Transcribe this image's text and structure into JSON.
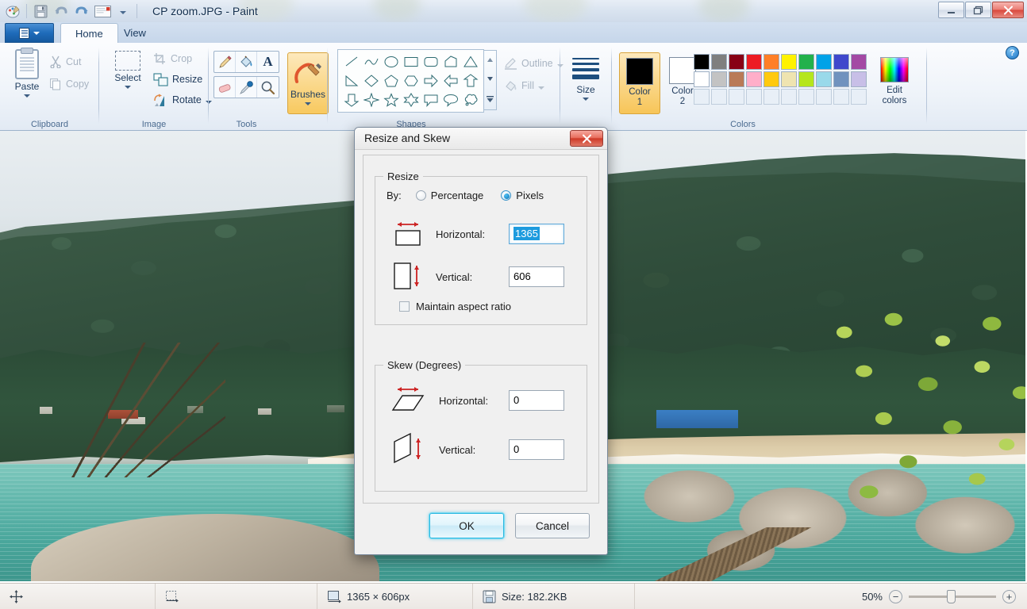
{
  "window": {
    "title": "CP zoom.JPG - Paint",
    "minimize_label": "—",
    "restore_label": "❐",
    "close_label": "✕",
    "help_label": "?"
  },
  "quick_access": {
    "items": [
      {
        "name": "paint-logo-icon",
        "label": ""
      },
      {
        "name": "save-icon",
        "label": ""
      },
      {
        "name": "undo-icon",
        "label": ""
      },
      {
        "name": "redo-icon",
        "label": ""
      },
      {
        "name": "email-icon",
        "label": ""
      },
      {
        "name": "customize-qat-dropdown-icon",
        "label": ""
      }
    ]
  },
  "tabs": {
    "file_menu_label": "",
    "items": [
      {
        "label": "Home",
        "active": true
      },
      {
        "label": "View",
        "active": false
      }
    ]
  },
  "ribbon": {
    "groups": [
      {
        "name": "clipboard",
        "label": "Clipboard"
      },
      {
        "name": "image",
        "label": "Image"
      },
      {
        "name": "tools",
        "label": "Tools"
      },
      {
        "name": "shapes",
        "label": "Shapes"
      },
      {
        "name": "colors",
        "label": "Colors"
      }
    ],
    "clipboard": {
      "paste_label": "Paste",
      "cut_label": "Cut",
      "copy_label": "Copy"
    },
    "image": {
      "select_label": "Select",
      "crop_label": "Crop",
      "resize_label": "Resize",
      "rotate_label": "Rotate"
    },
    "tools": {
      "items": [
        {
          "name": "pencil-tool-icon"
        },
        {
          "name": "fill-with-color-tool-icon"
        },
        {
          "name": "text-tool-icon"
        },
        {
          "name": "eraser-tool-icon"
        },
        {
          "name": "color-picker-tool-icon"
        },
        {
          "name": "magnifier-tool-icon"
        }
      ]
    },
    "brushes": {
      "label": "Brushes"
    },
    "shapes": {
      "row1": [
        "line",
        "curve",
        "oval",
        "rectangle",
        "rounded-rectangle",
        "polygon",
        "triangle"
      ],
      "row2": [
        "right-triangle",
        "diamond",
        "pentagon",
        "hexagon",
        "right-arrow",
        "left-arrow",
        "up-arrow"
      ],
      "row3": [
        "down-arrow",
        "four-point-star",
        "five-point-star",
        "six-point-star",
        "rectangular-callout",
        "rounded-callout",
        "cloud-callout"
      ],
      "outline_label": "Outline",
      "fill_label": "Fill"
    },
    "size": {
      "label": "Size"
    },
    "color1": {
      "label_line1": "Color",
      "label_line2": "1",
      "value": "#000000"
    },
    "color2": {
      "label_line1": "Color",
      "label_line2": "2",
      "value": "#ffffff"
    },
    "edit_colors": {
      "label_line1": "Edit",
      "label_line2": "colors"
    },
    "palette": {
      "row1": [
        "#000000",
        "#7f7f7f",
        "#880015",
        "#ed1c24",
        "#ff7f27",
        "#fff200",
        "#22b14c",
        "#00a2e8",
        "#3f48cc",
        "#a349a4"
      ],
      "row2": [
        "#ffffff",
        "#c3c3c3",
        "#b97a57",
        "#ffaec9",
        "#ffc90e",
        "#efe4b0",
        "#b5e61d",
        "#99d9ea",
        "#7092be",
        "#c8bfe7"
      ],
      "row3": [
        "",
        "",
        "",
        "",
        "",
        "",
        "",
        "",
        "",
        ""
      ]
    }
  },
  "dialog": {
    "title": "Resize and Skew",
    "close_label": "✕",
    "resize": {
      "legend": "Resize",
      "by_label": "By:",
      "percentage_label": "Percentage",
      "percentage_selected": false,
      "pixels_label": "Pixels",
      "pixels_selected": true,
      "horizontal_label": "Horizontal:",
      "horizontal_value": "1365",
      "vertical_label": "Vertical:",
      "vertical_value": "606",
      "maintain_aspect_label": "Maintain aspect ratio",
      "maintain_aspect_checked": false
    },
    "skew": {
      "legend": "Skew (Degrees)",
      "horizontal_label": "Horizontal:",
      "horizontal_value": "0",
      "vertical_label": "Vertical:",
      "vertical_value": "0"
    },
    "ok_label": "OK",
    "cancel_label": "Cancel"
  },
  "statusbar": {
    "cursor_position": "",
    "selection_size": "",
    "image_size": "1365 × 606px",
    "file_size": "Size: 182.2KB",
    "zoom_level": "50%",
    "zoom_out_label": "−",
    "zoom_in_label": "+"
  }
}
